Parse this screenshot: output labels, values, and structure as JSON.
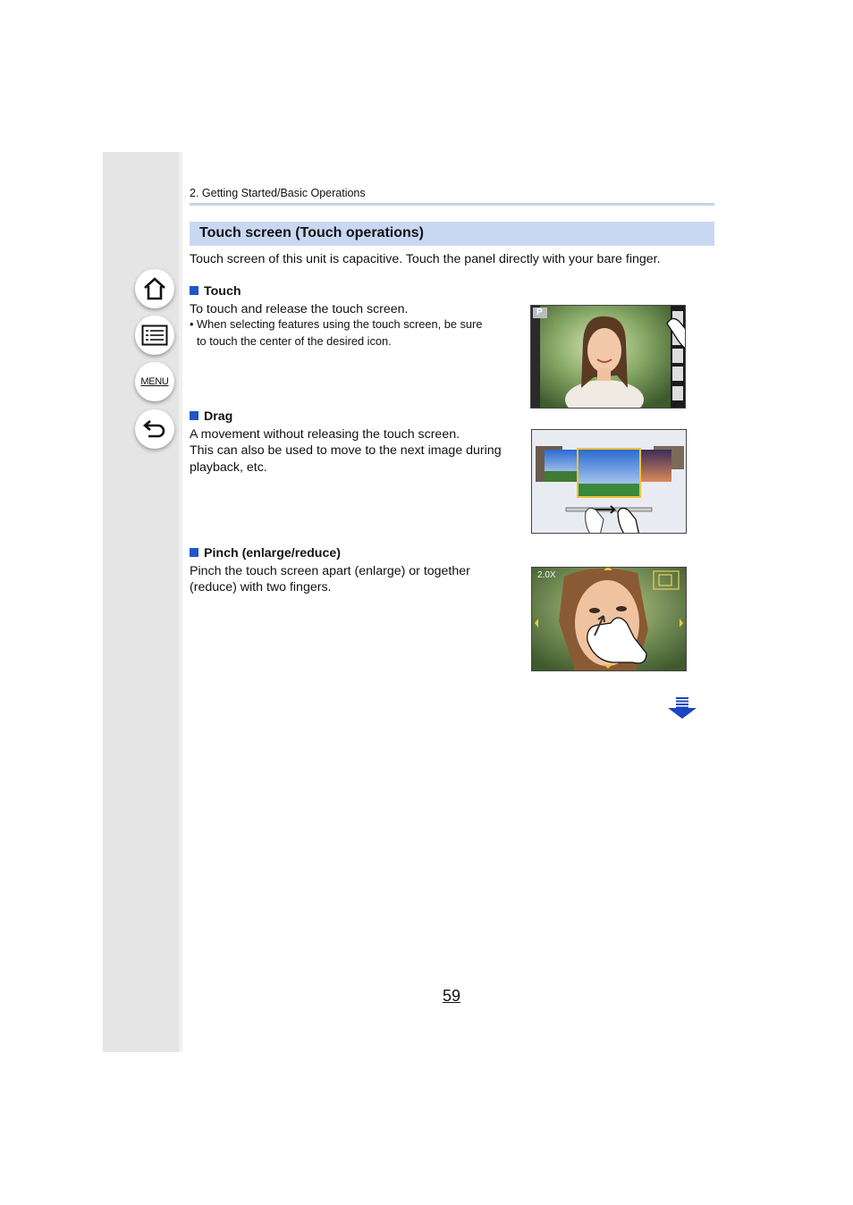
{
  "breadcrumb": "2. Getting Started/Basic Operations",
  "section": {
    "title": "Touch screen (Touch operations)"
  },
  "intro": "Touch screen of this unit is capacitive. Touch the panel directly with your bare finger.",
  "nav": {
    "home_icon": "home-icon",
    "contents_icon": "list-icon",
    "menu_label": "MENU",
    "back_icon": "back-arrow-icon"
  },
  "touch": {
    "heading": "Touch",
    "line1": "To touch and release the touch screen.",
    "note1": "• When selecting features using the touch screen, be sure",
    "note2": "to touch the center of the desired icon.",
    "mode_label": "P"
  },
  "drag": {
    "heading": "Drag",
    "line1": "A movement without releasing the touch screen.",
    "line2": "This can also be used to move to the next image during",
    "line3": "playback, etc."
  },
  "pinch": {
    "heading": "Pinch (enlarge/reduce)",
    "line1": "Pinch the touch screen apart (enlarge) or together",
    "line2": "(reduce) with two fingers.",
    "zoom_label": "2.0X"
  },
  "page_number": "59",
  "colors": {
    "sidebar": "#e5e5e5",
    "section_bar": "#c9d8f2",
    "bullet": "#1f56c8",
    "arrow": "#1a45c2"
  }
}
